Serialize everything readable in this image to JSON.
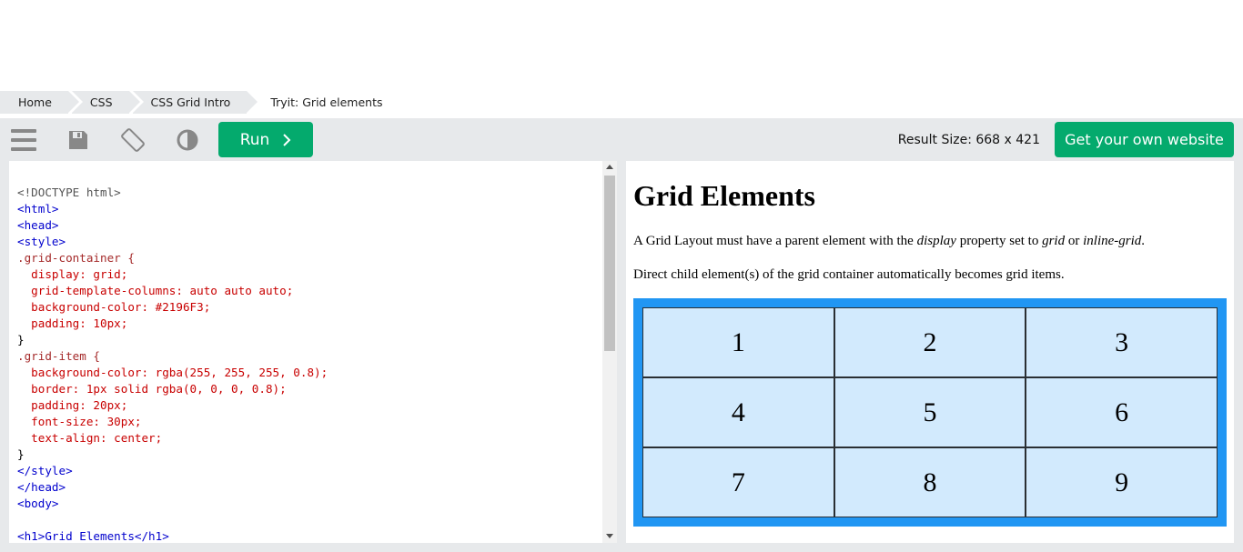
{
  "breadcrumb": [
    "Home",
    "CSS",
    "CSS Grid Intro",
    "Tryit: Grid elements"
  ],
  "toolbar": {
    "run_label": "Run",
    "result_size": "Result Size: 668 x 421",
    "get_website_label": "Get your own website",
    "icons": [
      "menu-icon",
      "save-icon",
      "rotate-icon",
      "contrast-icon"
    ]
  },
  "colors": {
    "accent": "#04aa6d",
    "grid_bg": "#2196F3"
  },
  "editor": {
    "lines": [
      "<!DOCTYPE html>",
      "<html>",
      "<head>",
      "<style>",
      ".grid-container {",
      "  display: grid;",
      "  grid-template-columns: auto auto auto;",
      "  background-color: #2196F3;",
      "  padding: 10px;",
      "}",
      ".grid-item {",
      "  background-color: rgba(255, 255, 255, 0.8);",
      "  border: 1px solid rgba(0, 0, 0, 0.8);",
      "  padding: 20px;",
      "  font-size: 30px;",
      "  text-align: center;",
      "}",
      "</style>",
      "</head>",
      "<body>",
      "",
      "<h1>Grid Elements</h1>"
    ]
  },
  "result": {
    "heading": "Grid Elements",
    "p1_before": "A Grid Layout must have a parent element with the ",
    "p1_em1": "display",
    "p1_mid": " property set to ",
    "p1_em2": "grid",
    "p1_or": " or ",
    "p1_em3": "inline-grid",
    "p1_end": ".",
    "p2": "Direct child element(s) of the grid container automatically becomes grid items.",
    "grid_items": [
      "1",
      "2",
      "3",
      "4",
      "5",
      "6",
      "7",
      "8",
      "9"
    ]
  }
}
